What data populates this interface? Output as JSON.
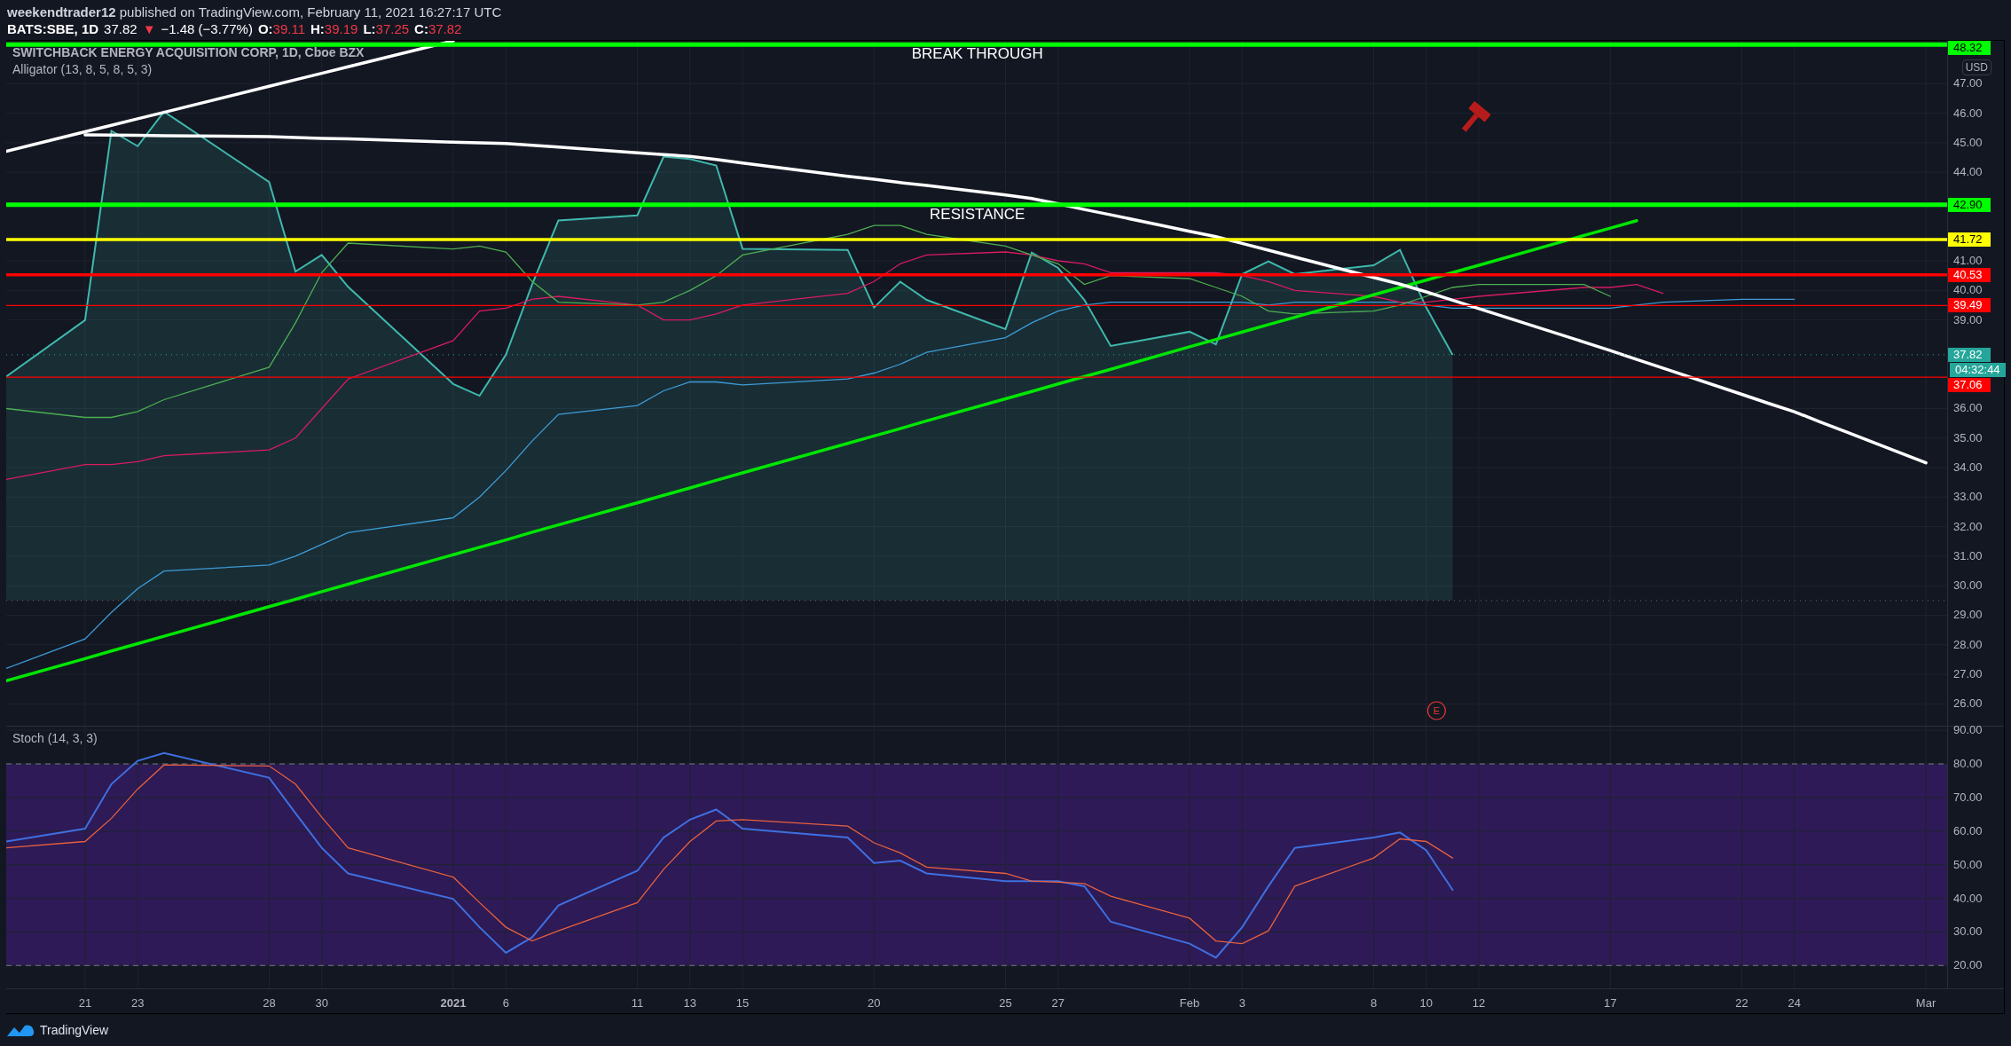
{
  "header": {
    "published": "**weekendtrader12** published on TradingView.com, February 11, 2021 16:27:17 UTC",
    "quote": {
      "symbol": "BATS:SBE, 1D",
      "last": "37.82",
      "arrow": "▼",
      "change": "−1.48 (−3.77%)",
      "color": "#f23645",
      "ohlc": [
        {
          "key": "O:",
          "value": "39.11"
        },
        {
          "key": "H:",
          "value": "39.19"
        },
        {
          "key": "L:",
          "value": "37.25"
        },
        {
          "key": "C:",
          "value": "37.82"
        }
      ]
    }
  },
  "main_pane": {
    "legend": [
      "SWITCHBACK ENERGY ACQUISITION CORP, 1D, Cboe BZX",
      "Alligator (13, 8, 5, 8, 5, 3)"
    ],
    "currency": "USD",
    "last_price": {
      "label": "37.82",
      "countdown": "04:32:44",
      "color": "#26a69a"
    },
    "events": [
      {
        "label": "E",
        "color": "#e53935"
      }
    ],
    "chart_data": {
      "type": "line",
      "grid": true,
      "x": [
        "2020-12-18",
        "2020-12-21",
        "2020-12-22",
        "2020-12-23",
        "2020-12-24",
        "2020-12-28",
        "2020-12-29",
        "2020-12-30",
        "2020-12-31",
        "2021-01-04",
        "2021-01-05",
        "2021-01-06",
        "2021-01-07",
        "2021-01-08",
        "2021-01-11",
        "2021-01-12",
        "2021-01-13",
        "2021-01-14",
        "2021-01-15",
        "2021-01-19",
        "2021-01-20",
        "2021-01-21",
        "2021-01-22",
        "2021-01-25",
        "2021-01-26",
        "2021-01-27",
        "2021-01-28",
        "2021-01-29",
        "2021-02-01",
        "2021-02-02",
        "2021-02-03",
        "2021-02-04",
        "2021-02-05",
        "2021-02-08",
        "2021-02-09",
        "2021-02-10",
        "2021-02-11",
        "2021-02-12",
        "2021-02-16",
        "2021-02-17",
        "2021-02-18",
        "2021-02-19",
        "2021-02-22",
        "2021-02-23",
        "2021-02-24",
        "2021-02-25",
        "2021-02-26",
        "2021-03-01"
      ],
      "xlim": [
        "2020-12-18",
        "2021-03-04"
      ],
      "ylim": [
        25.26,
        48.45
      ],
      "yticks": [
        {
          "value": 47,
          "label": "47.00"
        },
        {
          "value": 46,
          "label": "46.00"
        },
        {
          "value": 45,
          "label": "45.00"
        },
        {
          "value": 44,
          "label": "44.00"
        },
        {
          "value": 41,
          "label": "41.00"
        },
        {
          "value": 40,
          "label": "40.00"
        },
        {
          "value": 39,
          "label": "39.00"
        },
        {
          "value": 36,
          "label": "36.00"
        },
        {
          "value": 35,
          "label": "35.00"
        },
        {
          "value": 34,
          "label": "34.00"
        },
        {
          "value": 33,
          "label": "33.00"
        },
        {
          "value": 32,
          "label": "32.00"
        },
        {
          "value": 31,
          "label": "31.00"
        },
        {
          "value": 30,
          "label": "30.00"
        },
        {
          "value": 29,
          "label": "29.00"
        },
        {
          "value": 28,
          "label": "28.00"
        },
        {
          "value": 27,
          "label": "27.00"
        },
        {
          "value": 26,
          "label": "26.00"
        }
      ],
      "series": [
        {
          "type": "area",
          "color": "#3fb8ac",
          "values": [
            37.08,
            38.99,
            45.4,
            44.88,
            46.05,
            43.67,
            40.64,
            41.2,
            40.12,
            36.83,
            36.43,
            37.82,
            40.2,
            42.37,
            42.54,
            44.53,
            44.45,
            44.23,
            41.41,
            41.37,
            39.42,
            40.29,
            39.68,
            38.69,
            41.28,
            40.76,
            39.68,
            38.12,
            38.6,
            38.17,
            40.55,
            40.98,
            40.55,
            40.85,
            41.37,
            39.42,
            37.82,
            null,
            null,
            null,
            null,
            null,
            null,
            null,
            null,
            null,
            null,
            null
          ]
        },
        {
          "color": "#3d9cd6",
          "values": [
            27.2,
            28.2,
            29.1,
            29.9,
            30.5,
            30.7,
            31.0,
            31.4,
            31.8,
            32.3,
            33.0,
            33.9,
            34.9,
            35.8,
            36.1,
            36.6,
            36.9,
            36.9,
            36.8,
            37.0,
            37.2,
            37.5,
            37.9,
            38.4,
            38.9,
            39.3,
            39.5,
            39.6,
            39.6,
            39.6,
            39.6,
            39.5,
            39.6,
            39.6,
            39.6,
            39.5,
            39.4,
            39.4,
            39.4,
            39.4,
            39.5,
            39.6,
            39.7,
            39.7,
            39.7,
            null,
            null,
            null
          ]
        },
        {
          "color": "#d81b60",
          "values": [
            33.6,
            34.1,
            34.1,
            34.2,
            34.4,
            34.6,
            35.0,
            36.0,
            37.0,
            38.3,
            39.3,
            39.4,
            39.7,
            39.8,
            39.5,
            39.0,
            39.0,
            39.2,
            39.5,
            39.9,
            40.3,
            40.9,
            41.2,
            41.3,
            41.2,
            41.0,
            40.9,
            40.6,
            40.6,
            40.6,
            40.5,
            40.3,
            40.0,
            39.8,
            39.6,
            39.6,
            39.7,
            39.8,
            40.1,
            40.1,
            40.2,
            39.9,
            null,
            null,
            null,
            null,
            null,
            null
          ]
        },
        {
          "color": "#4caf50",
          "values": [
            36.0,
            35.7,
            35.7,
            35.9,
            36.3,
            37.4,
            38.9,
            40.6,
            41.6,
            41.4,
            41.5,
            41.3,
            40.3,
            39.6,
            39.5,
            39.6,
            40.0,
            40.5,
            41.2,
            41.9,
            42.2,
            42.2,
            41.9,
            41.5,
            41.2,
            40.9,
            40.2,
            40.5,
            40.4,
            40.1,
            39.8,
            39.3,
            39.2,
            39.3,
            39.5,
            39.8,
            40.1,
            40.2,
            40.2,
            39.8,
            null,
            null,
            null,
            null,
            null,
            null,
            null,
            null
          ]
        },
        {
          "color": "#ffffff",
          "values": [
            44.71,
            45.37,
            45.59,
            45.81,
            46.03,
            46.91,
            47.13,
            47.35,
            47.57,
            48.45,
            null,
            null,
            null,
            null,
            null,
            null,
            null,
            null,
            null,
            null,
            null,
            null,
            null,
            null,
            null,
            null,
            null,
            null,
            null,
            null,
            null,
            null,
            null,
            null,
            null,
            null,
            null,
            null,
            null,
            null,
            null,
            null,
            null,
            null,
            null,
            null,
            null,
            null
          ]
        },
        {
          "color": "#00e600",
          "values": [
            26.78,
            27.53,
            27.79,
            28.04,
            28.29,
            29.29,
            29.54,
            29.8,
            30.05,
            31.05,
            31.3,
            31.55,
            31.81,
            32.06,
            32.81,
            33.06,
            33.31,
            33.57,
            33.82,
            34.82,
            35.07,
            35.32,
            35.58,
            36.33,
            36.58,
            36.83,
            37.08,
            37.33,
            38.09,
            38.34,
            38.59,
            38.84,
            39.09,
            39.85,
            40.1,
            40.35,
            40.6,
            40.85,
            41.86,
            42.11,
            42.36,
            null,
            null,
            null,
            null,
            null,
            null,
            null
          ]
        },
        {
          "color": "#ffffff",
          "values": [
            null,
            45.27,
            45.26,
            45.25,
            45.24,
            45.21,
            45.18,
            45.15,
            45.13,
            45.02,
            45.0,
            44.97,
            44.91,
            44.85,
            44.66,
            44.6,
            44.54,
            44.43,
            44.31,
            43.86,
            43.76,
            43.65,
            43.55,
            43.23,
            43.11,
            42.93,
            42.74,
            42.56,
            42.0,
            41.82,
            41.59,
            41.36,
            41.13,
            40.44,
            40.21,
            39.95,
            39.67,
            39.38,
            38.25,
            37.96,
            37.66,
            37.37,
            36.48,
            36.18,
            35.89,
            35.54,
            35.2,
            34.16
          ]
        }
      ],
      "ref_lines": [
        {
          "axis": "y",
          "value": 48.32,
          "label": "48.32",
          "color": "#00ff00"
        },
        {
          "axis": "y",
          "value": 42.9,
          "label": "42.90",
          "color": "#00ff00"
        },
        {
          "axis": "y",
          "value": 41.72,
          "label": "41.72",
          "color": "#ffff00"
        },
        {
          "axis": "y",
          "value": 40.53,
          "label": "40.53",
          "color": "#ff0000"
        },
        {
          "axis": "y",
          "value": 39.49,
          "label": "39.49",
          "color": "#ff0000"
        },
        {
          "axis": "y",
          "value": 37.06,
          "label": "37.06",
          "color": "#ff0000"
        },
        {
          "axis": "y",
          "value": 37.82,
          "color": "#26a69a"
        },
        {
          "axis": "y",
          "value": 29.5,
          "color": "#6a6d78"
        }
      ],
      "annotations": [
        "BREAK THROUGH",
        "RESISTANCE"
      ]
    }
  },
  "stoch_pane": {
    "legend": "Stoch (14, 3, 3)",
    "chart_data": {
      "type": "line",
      "grid": true,
      "x": [
        "2020-12-18",
        "2020-12-21",
        "2020-12-22",
        "2020-12-23",
        "2020-12-24",
        "2020-12-28",
        "2020-12-29",
        "2020-12-30",
        "2020-12-31",
        "2021-01-04",
        "2021-01-05",
        "2021-01-06",
        "2021-01-07",
        "2021-01-08",
        "2021-01-11",
        "2021-01-12",
        "2021-01-13",
        "2021-01-14",
        "2021-01-15",
        "2021-01-19",
        "2021-01-20",
        "2021-01-21",
        "2021-01-22",
        "2021-01-25",
        "2021-01-26",
        "2021-01-27",
        "2021-01-28",
        "2021-01-29",
        "2021-02-01",
        "2021-02-02",
        "2021-02-03",
        "2021-02-04",
        "2021-02-05",
        "2021-02-08",
        "2021-02-09",
        "2021-02-10",
        "2021-02-11"
      ],
      "xlim": [
        "2020-12-18",
        "2021-03-04"
      ],
      "ylim": [
        13.2,
        91.1
      ],
      "xticks": [
        {
          "value": "2020-12-21",
          "label": "21"
        },
        {
          "value": "2020-12-23",
          "label": "23"
        },
        {
          "value": "2020-12-28",
          "label": "28"
        },
        {
          "value": "2020-12-30",
          "label": "30"
        },
        {
          "value": "2021-01-04",
          "label": "**2021**"
        },
        {
          "value": "2021-01-06",
          "label": "6"
        },
        {
          "value": "2021-01-11",
          "label": "11"
        },
        {
          "value": "2021-01-13",
          "label": "13"
        },
        {
          "value": "2021-01-15",
          "label": "15"
        },
        {
          "value": "2021-01-20",
          "label": "20"
        },
        {
          "value": "2021-01-25",
          "label": "25"
        },
        {
          "value": "2021-01-27",
          "label": "27"
        },
        {
          "value": "2021-02-01",
          "label": "Feb"
        },
        {
          "value": "2021-02-03",
          "label": "3"
        },
        {
          "value": "2021-02-08",
          "label": "8"
        },
        {
          "value": "2021-02-10",
          "label": "10"
        },
        {
          "value": "2021-02-12",
          "label": "12"
        },
        {
          "value": "2021-02-17",
          "label": "17"
        },
        {
          "value": "2021-02-22",
          "label": "22"
        },
        {
          "value": "2021-02-24",
          "label": "24"
        },
        {
          "value": "2021-03-01",
          "label": "Mar"
        }
      ],
      "yticks": [
        {
          "value": 90,
          "label": "90.00"
        },
        {
          "value": 80,
          "label": "80.00"
        },
        {
          "value": 70,
          "label": "70.00"
        },
        {
          "value": 60,
          "label": "60.00"
        },
        {
          "value": 50,
          "label": "50.00"
        },
        {
          "value": 40,
          "label": "40.00"
        },
        {
          "value": 30,
          "label": "30.00"
        },
        {
          "value": 20,
          "label": "20.00"
        }
      ],
      "series": [
        {
          "color": "#3f6fe0",
          "values": [
            56.9,
            60.7,
            74.0,
            80.9,
            83.2,
            75.9,
            65.3,
            55.0,
            47.4,
            39.8,
            31.4,
            23.8,
            28.4,
            37.9,
            48.2,
            58.1,
            63.4,
            66.4,
            60.7,
            58.1,
            50.5,
            51.2,
            47.4,
            45.1,
            45.1,
            45.1,
            43.6,
            33.0,
            26.5,
            22.3,
            31.4,
            43.6,
            55.0,
            58.1,
            59.6,
            54.3,
            42.5
          ]
        },
        {
          "color": "#e8603c",
          "values": [
            55.0,
            56.9,
            63.8,
            72.5,
            79.7,
            79.4,
            74.0,
            64.1,
            55.0,
            46.3,
            38.7,
            31.4,
            27.3,
            30.3,
            38.7,
            48.6,
            56.9,
            63.0,
            63.4,
            61.5,
            56.5,
            53.5,
            49.3,
            47.4,
            45.1,
            44.8,
            44.4,
            40.6,
            34.1,
            27.3,
            26.5,
            30.3,
            43.6,
            52.0,
            57.7,
            56.9,
            52.0
          ]
        }
      ],
      "bands": [
        {
          "axis": "y",
          "from": 20,
          "to": 80,
          "color": "#2d1a56"
        }
      ]
    }
  },
  "footer": {
    "brand": "TradingView"
  }
}
